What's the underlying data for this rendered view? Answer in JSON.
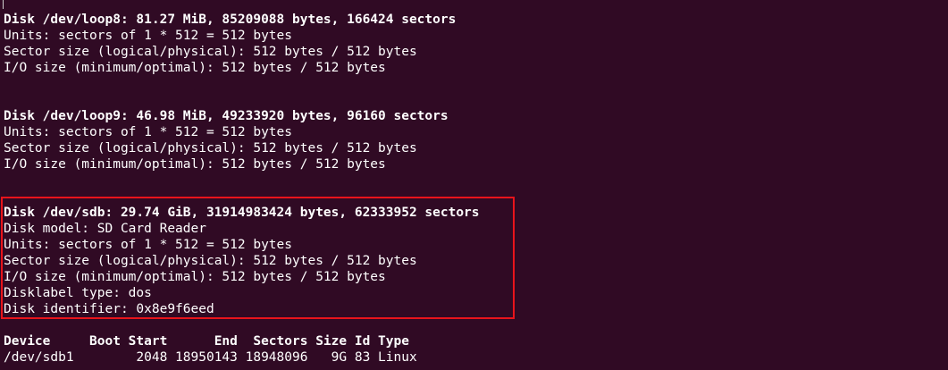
{
  "terminal": {
    "background": "#300a24",
    "foreground": "#ffffff",
    "highlight_color": "#e8141b",
    "loop8": {
      "header": "Disk /dev/loop8: 81.27 MiB, 85209088 bytes, 166424 sectors",
      "units": "Units: sectors of 1 * 512 = 512 bytes",
      "sector_size": "Sector size (logical/physical): 512 bytes / 512 bytes",
      "io_size": "I/O size (minimum/optimal): 512 bytes / 512 bytes"
    },
    "loop9": {
      "header": "Disk /dev/loop9: 46.98 MiB, 49233920 bytes, 96160 sectors",
      "units": "Units: sectors of 1 * 512 = 512 bytes",
      "sector_size": "Sector size (logical/physical): 512 bytes / 512 bytes",
      "io_size": "I/O size (minimum/optimal): 512 bytes / 512 bytes"
    },
    "sdb": {
      "header": "Disk /dev/sdb: 29.74 GiB, 31914983424 bytes, 62333952 sectors",
      "model": "Disk model: SD Card Reader",
      "units": "Units: sectors of 1 * 512 = 512 bytes",
      "sector_size": "Sector size (logical/physical): 512 bytes / 512 bytes",
      "io_size": "I/O size (minimum/optimal): 512 bytes / 512 bytes",
      "disklabel": "Disklabel type: dos",
      "identifier": "Disk identifier: 0x8e9f6eed"
    },
    "partition_table": {
      "header": "Device     Boot Start      End  Sectors Size Id Type",
      "rows": [
        "/dev/sdb1        2048 18950143 18948096   9G 83 Linux"
      ]
    }
  }
}
